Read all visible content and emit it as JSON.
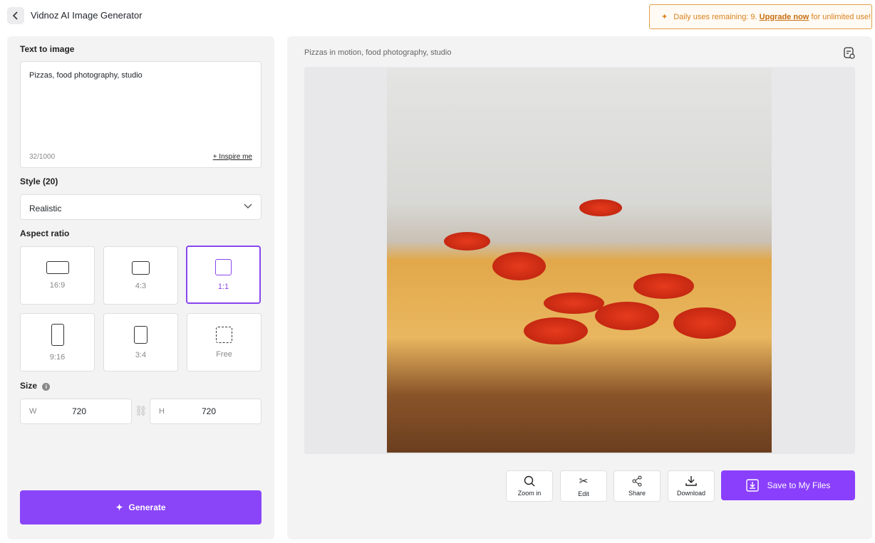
{
  "header": {
    "title": "Vidnoz AI Image Generator",
    "banner_prefix": "Daily uses remaining: 9. ",
    "banner_link": "Upgrade now",
    "banner_suffix": " for unlimited use!"
  },
  "left": {
    "text_label": "Text to image",
    "prompt": "Pizzas, food photography, studio",
    "char_count": "32/1000",
    "inspire": "+ Inspire me",
    "style_label": "Style (20)",
    "style_value": "Realistic",
    "aspect_label": "Aspect ratio",
    "aspects": [
      "16:9",
      "4:3",
      "1:1",
      "9:16",
      "3:4",
      "Free"
    ],
    "selected_aspect": "1:1",
    "size_label": "Size",
    "w_label": "W",
    "w_value": "720",
    "h_label": "H",
    "h_value": "720",
    "generate": "Generate"
  },
  "right": {
    "prompt": "Pizzas in motion, food photography, studio",
    "actions": [
      "Zoom in",
      "Edit",
      "Share",
      "Download"
    ],
    "save": "Save to My Files"
  },
  "colors": {
    "accent": "#8a45f8",
    "banner": "#d9821f"
  }
}
